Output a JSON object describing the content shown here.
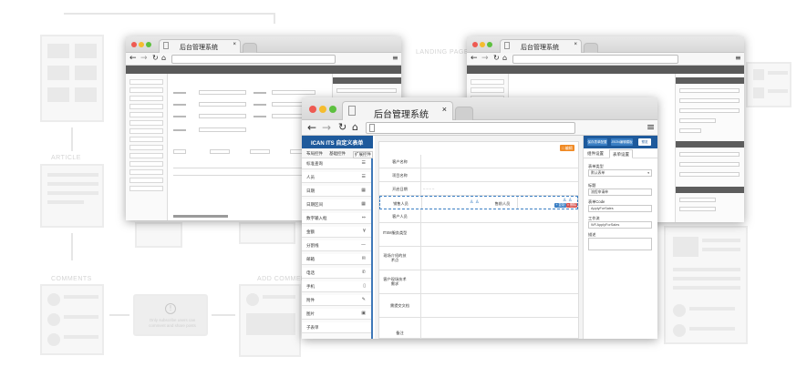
{
  "background": {
    "labels": [
      "LANDING PAGE",
      "ARTICLE",
      "COMMENTS",
      "ADD COMMENTS"
    ],
    "notice_text": "Only subscribe users can comment and share posts"
  },
  "windows": {
    "back_left": {
      "tab_title": "后台管理系统"
    },
    "back_right": {
      "tab_title": "后台管理系统"
    },
    "front": {
      "tab_title": "后台管理系统"
    }
  },
  "app": {
    "title": "ICAN ITS 自定义表单",
    "left_tabs": [
      "布局控件",
      "基础控件",
      "扩展控件"
    ],
    "left_items": [
      {
        "label": "标准查询",
        "icon": "search-list-icon",
        "glyph": "☰"
      },
      {
        "label": "人员",
        "icon": "people-icon",
        "glyph": "☰"
      },
      {
        "label": "日期",
        "icon": "calendar-icon",
        "glyph": "▦"
      },
      {
        "label": "日期区间",
        "icon": "calendar-range-icon",
        "glyph": "▦"
      },
      {
        "label": "数字输入框",
        "icon": "number-icon",
        "glyph": "⇔"
      },
      {
        "label": "金额",
        "icon": "money-icon",
        "glyph": "¥"
      },
      {
        "label": "分割线",
        "icon": "divider-icon",
        "glyph": "—"
      },
      {
        "label": "邮箱",
        "icon": "mail-icon",
        "glyph": "✉"
      },
      {
        "label": "电话",
        "icon": "phone-icon",
        "glyph": "✆"
      },
      {
        "label": "手机",
        "icon": "mobile-icon",
        "glyph": "▯"
      },
      {
        "label": "附件",
        "icon": "attachment-icon",
        "glyph": "✎"
      },
      {
        "label": "图片",
        "icon": "image-icon",
        "glyph": "▣"
      },
      {
        "label": "子表单",
        "icon": "subform-icon",
        "glyph": ""
      }
    ],
    "top_badge": "□ 编辑",
    "form_rows": [
      {
        "label": "客户名称"
      },
      {
        "label": "项目名称"
      },
      {
        "label": "开启日期"
      },
      {
        "label": "销售人员",
        "extra_label": "售前人员"
      },
      {
        "label": "客户人员"
      },
      {
        "label": "ITSM服务类型"
      },
      {
        "label": "现场介绍的技术点"
      },
      {
        "label": "客户现场技术需求"
      },
      {
        "label": "需提交文档"
      },
      {
        "label": "备注"
      }
    ],
    "row_actions": [
      "× 删除",
      "+ 复制"
    ],
    "right_buttons": [
      "保存表单配置",
      "JSON编辑模板",
      "预览"
    ],
    "right_tabs": [
      "组件设置",
      "表单设置"
    ],
    "right_fields": [
      {
        "label": "表单类型",
        "value": "默认表单"
      },
      {
        "label": "标题",
        "value": "流程申请单"
      },
      {
        "label": "表单Code",
        "value": "ApplyForSales"
      },
      {
        "label": "工作流",
        "value": "WF.ApplyForSales"
      },
      {
        "label": "描述",
        "value": ""
      }
    ],
    "colors": {
      "header_blue": "#1e5a9c",
      "badge_orange": "#f08a24",
      "btn_blue": "#3b7fc4",
      "btn_red": "#d9534f"
    }
  }
}
